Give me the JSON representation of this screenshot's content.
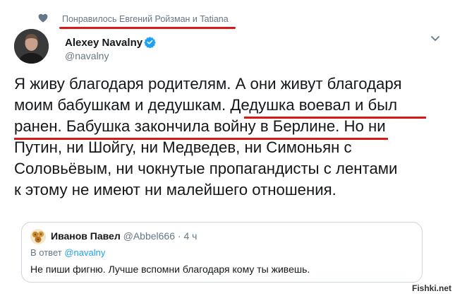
{
  "liked_by": "Понравилось Евгений Ройзман и Tatiana",
  "author": {
    "name": "Alexey Navalny",
    "handle": "@navalny"
  },
  "tweet_lines": [
    "Я живу благодаря родителям. А они живут благодаря",
    "моим бабушкам и дедушкам. Дедушка воевал и был",
    "ранен. Бабушка закончила войну в Берлине. Но ни",
    "Путин, ни Шойгу, ни Медведев, ни Симоньян с",
    "Соловьёвым, ни чокнутые пропагандисты с лентами",
    "к этому не имеют ни малейшего отношения."
  ],
  "quoted": {
    "name": "Иванов Павел",
    "handle": "@Abbel666",
    "separator": "·",
    "time": "4 ч",
    "reply_prefix": "В ответ",
    "reply_to": "@navalny",
    "text": "Не пиши фигню. Лучше вспомни благодаря кому ты живешь."
  },
  "watermark": "Fishki.net",
  "colors": {
    "annotation_red": "#d61919",
    "twitter_blue": "#1da1f2",
    "secondary_gray": "#657786"
  },
  "icons": [
    "heart-icon",
    "verified-badge-icon",
    "chevron-down-icon"
  ]
}
